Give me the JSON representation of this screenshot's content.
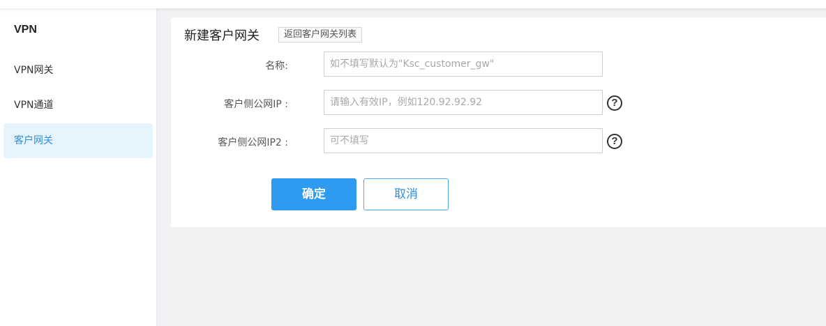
{
  "sidebar": {
    "title": "VPN",
    "items": [
      {
        "label": "VPN网关"
      },
      {
        "label": "VPN通道"
      },
      {
        "label": "客户网关"
      }
    ]
  },
  "panel": {
    "title": "新建客户网关",
    "back_link": "返回客户网关列表"
  },
  "form": {
    "name": {
      "label": "名称:",
      "value": "",
      "placeholder": "如不填写默认为\"Ksc_customer_gw\""
    },
    "public_ip": {
      "label": "客户侧公网IP :",
      "value": "",
      "placeholder": "请输入有效IP，例如120.92.92.92"
    },
    "public_ip2": {
      "label": "客户侧公网IP2 :",
      "value": "",
      "placeholder": "可不填写"
    },
    "help_glyph": "?"
  },
  "actions": {
    "confirm_label": "确定",
    "cancel_label": "取消"
  },
  "colors": {
    "accent": "#2e9bf0",
    "active_nav_bg": "#e6f4fd",
    "active_nav_text": "#2f8fd8"
  }
}
